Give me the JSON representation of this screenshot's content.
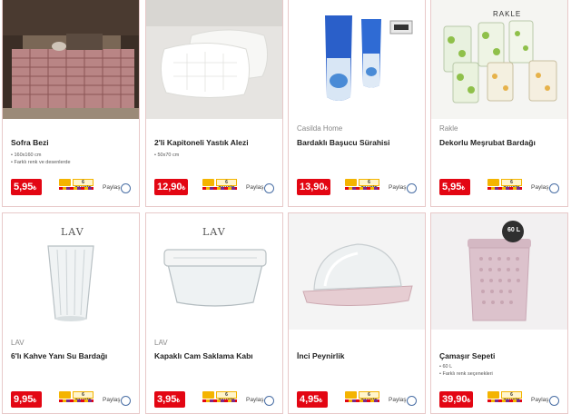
{
  "products": [
    {
      "brand": "",
      "name": "Sofra Bezi",
      "specs": [
        "• 160x160 cm",
        "• Farklı renk ve desenlerde"
      ],
      "price_main": "5,95",
      "price_cur": "₺"
    },
    {
      "brand": "",
      "name": "2'li Kapitoneli Yastık Alezi",
      "specs": [
        "• 50x70 cm"
      ],
      "price_main": "12,90",
      "price_cur": "₺"
    },
    {
      "brand": "Casilda Home",
      "name": "Bardaklı Başucu Sürahisi",
      "specs": [],
      "price_main": "13,90",
      "price_cur": "₺"
    },
    {
      "brand": "Rakle",
      "name": "Dekorlu Meşrubat Bardağı",
      "specs": [],
      "price_main": "5,95",
      "price_cur": "₺"
    },
    {
      "brand": "LAV",
      "name": "6'lı Kahve Yanı Su Bardağı",
      "specs": [],
      "price_main": "9,95",
      "price_cur": "₺"
    },
    {
      "brand": "LAV",
      "name": "Kapaklı Cam Saklama Kabı",
      "specs": [],
      "price_main": "3,95",
      "price_cur": "₺"
    },
    {
      "brand": "",
      "name": "İnci Peynirlik",
      "specs": [],
      "price_main": "4,95",
      "price_cur": "₺"
    },
    {
      "brand": "",
      "name": "Çamaşır Sepeti",
      "specs": [
        "• 60 L",
        "• Farklı renk seçenekleri"
      ],
      "price_main": "39,90",
      "price_cur": "₺"
    }
  ],
  "share_label": "Paylaş",
  "taksit_label": "6 TAKSİT",
  "image_text": {
    "lav_logo": "LAV",
    "rakle_logo": "RAKLE",
    "basket_badge": "60 L"
  },
  "colors": {
    "price_bg": "#e30613",
    "card_border": "#e8c9c9",
    "taksit_yellow": "#f4b400",
    "share_circle": "#4a6fa5"
  }
}
